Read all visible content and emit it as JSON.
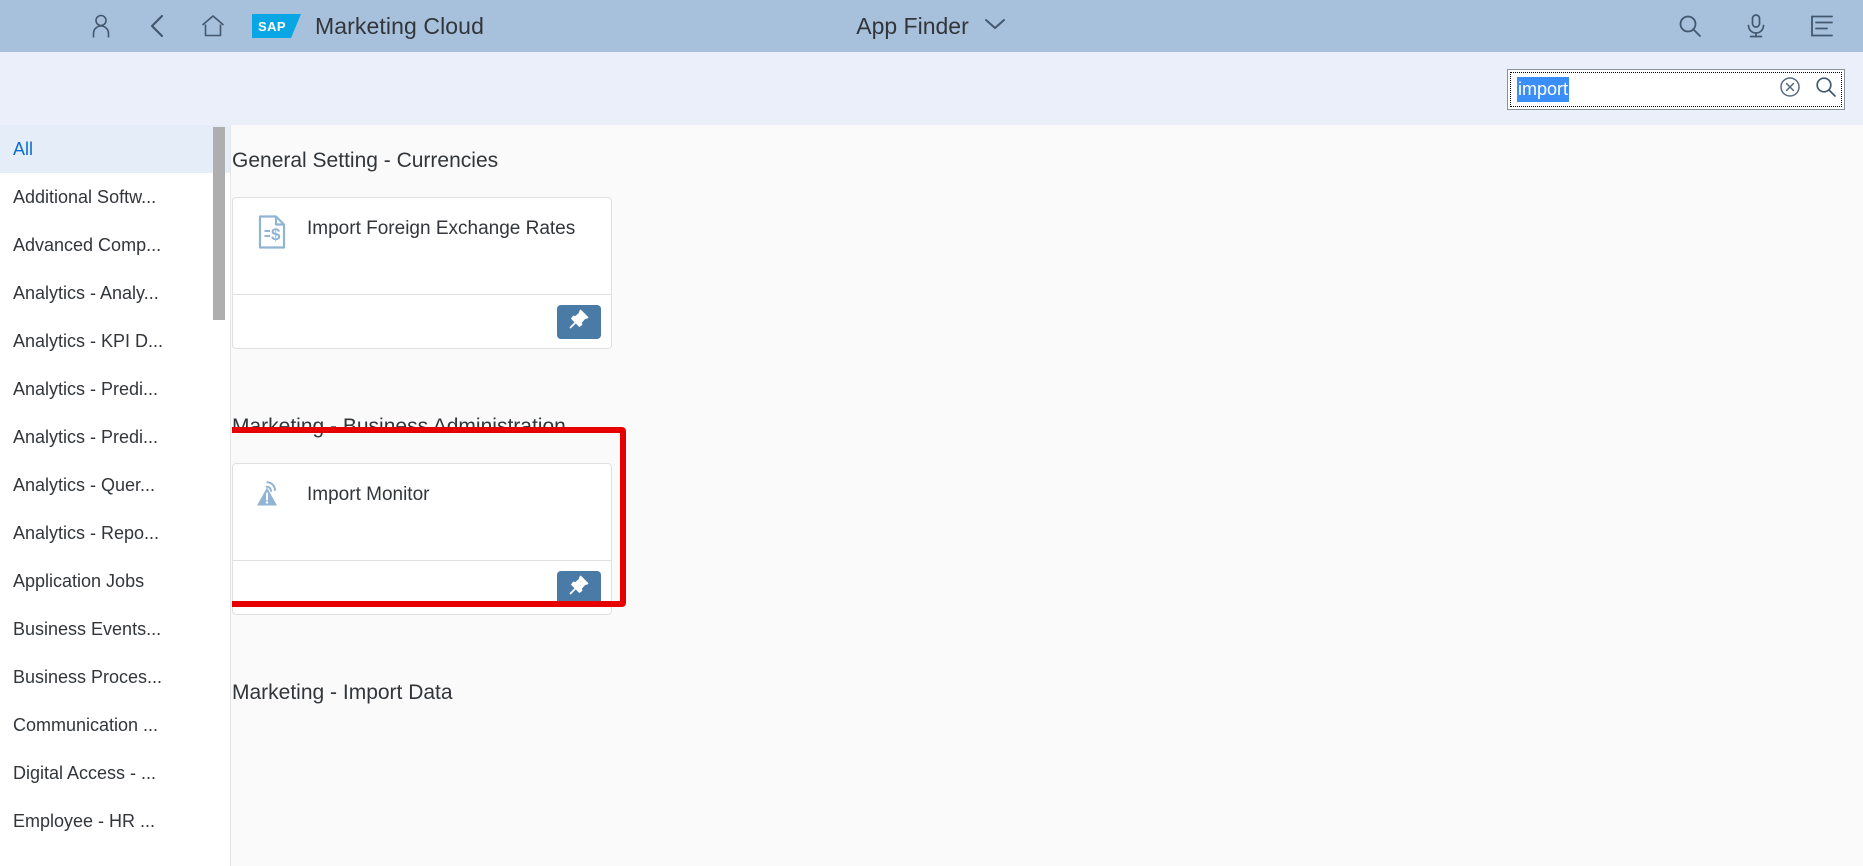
{
  "header": {
    "brand": "Marketing Cloud",
    "logo_text": "SAP",
    "app_title": "App Finder",
    "icons": {
      "user": "user-icon",
      "back": "back-icon",
      "home": "home-icon",
      "dropdown": "chevron-down-icon",
      "search": "search-icon",
      "microphone": "microphone-icon",
      "notifications": "notification-list-icon"
    }
  },
  "search": {
    "value": "import",
    "placeholder": "Search",
    "selected": true,
    "clear_label": "Clear",
    "submit_label": "Search"
  },
  "sidebar": {
    "items": [
      {
        "label": "All",
        "selected": true
      },
      {
        "label": "Additional Softw...",
        "selected": false
      },
      {
        "label": "Advanced Comp...",
        "selected": false
      },
      {
        "label": "Analytics - Analy...",
        "selected": false
      },
      {
        "label": "Analytics - KPI D...",
        "selected": false
      },
      {
        "label": "Analytics - Predi...",
        "selected": false
      },
      {
        "label": "Analytics - Predi...",
        "selected": false
      },
      {
        "label": "Analytics - Quer...",
        "selected": false
      },
      {
        "label": "Analytics - Repo...",
        "selected": false
      },
      {
        "label": "Application Jobs",
        "selected": false
      },
      {
        "label": "Business Events...",
        "selected": false
      },
      {
        "label": "Business Proces...",
        "selected": false
      },
      {
        "label": "Communication ...",
        "selected": false
      },
      {
        "label": "Digital Access - ...",
        "selected": false
      },
      {
        "label": "Employee - HR ...",
        "selected": false
      }
    ]
  },
  "main": {
    "groups": [
      {
        "title": "General Setting - Currencies",
        "tiles": [
          {
            "title": "Import Foreign Exchange Rates",
            "icon": "document-dollar-icon",
            "pin_label": "Pin",
            "highlighted": false
          }
        ]
      },
      {
        "title": "Marketing - Business Administration",
        "tiles": [
          {
            "title": "Import Monitor",
            "icon": "warning-signal-icon",
            "pin_label": "Pin",
            "highlighted": true
          }
        ]
      },
      {
        "title": "Marketing - Import Data",
        "tiles": []
      }
    ]
  },
  "colors": {
    "header_bg": "#a7c0dc",
    "subheader_bg": "#eaeff9",
    "content_bg": "#fafafa",
    "sidebar_selected": "#e5edf8",
    "accent_blue": "#0a6ed1",
    "pin_button": "#4a7ba7",
    "highlight_red": "#e60000",
    "selection_blue": "#3c8ef7",
    "icon_blue": "#91b4d5",
    "text_dark": "#32363a"
  }
}
